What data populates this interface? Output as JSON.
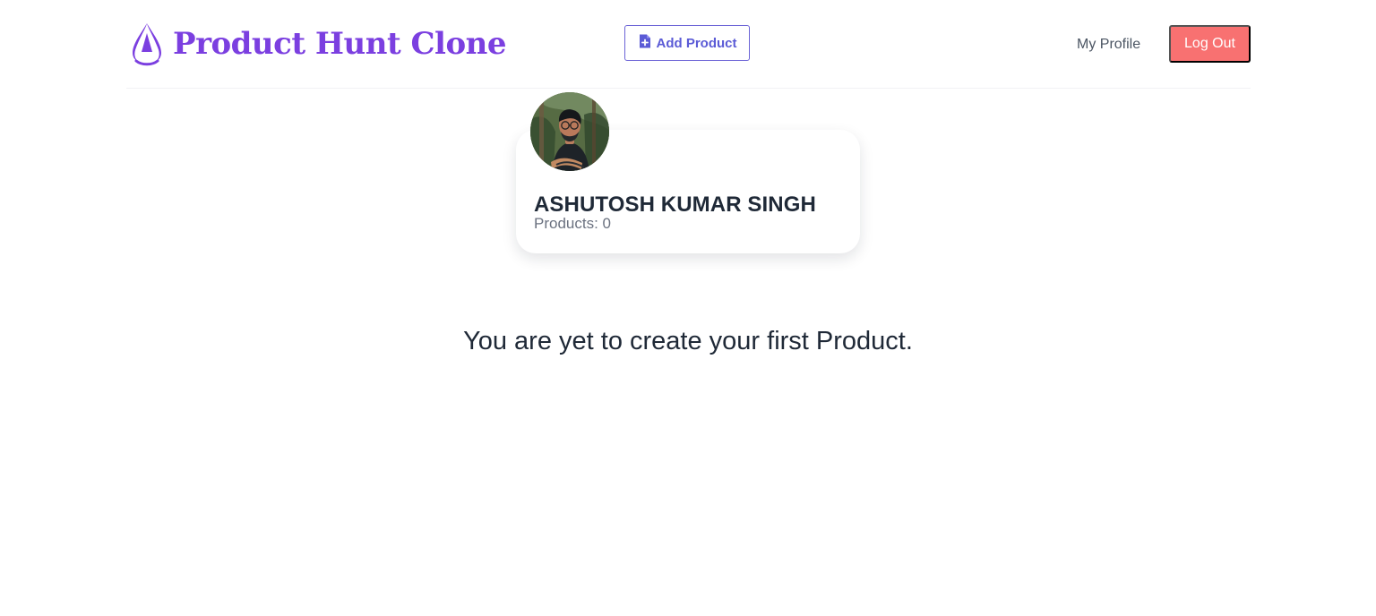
{
  "header": {
    "brand_title": "Product Hunt Clone",
    "brand_icon": "drop-triangle-logo-icon",
    "add_product_label": "Add Product",
    "add_product_icon": "file-plus-icon",
    "profile_link_label": "My Profile",
    "logout_label": "Log Out"
  },
  "profile": {
    "name": "ASHUTOSH KUMAR SINGH",
    "products_label": "Products: 0"
  },
  "main": {
    "empty_message": "You are yet to create your first Product."
  },
  "colors": {
    "brand": "#7b3fe0",
    "button_outline": "#6b63d6",
    "logout": "#f87171"
  }
}
